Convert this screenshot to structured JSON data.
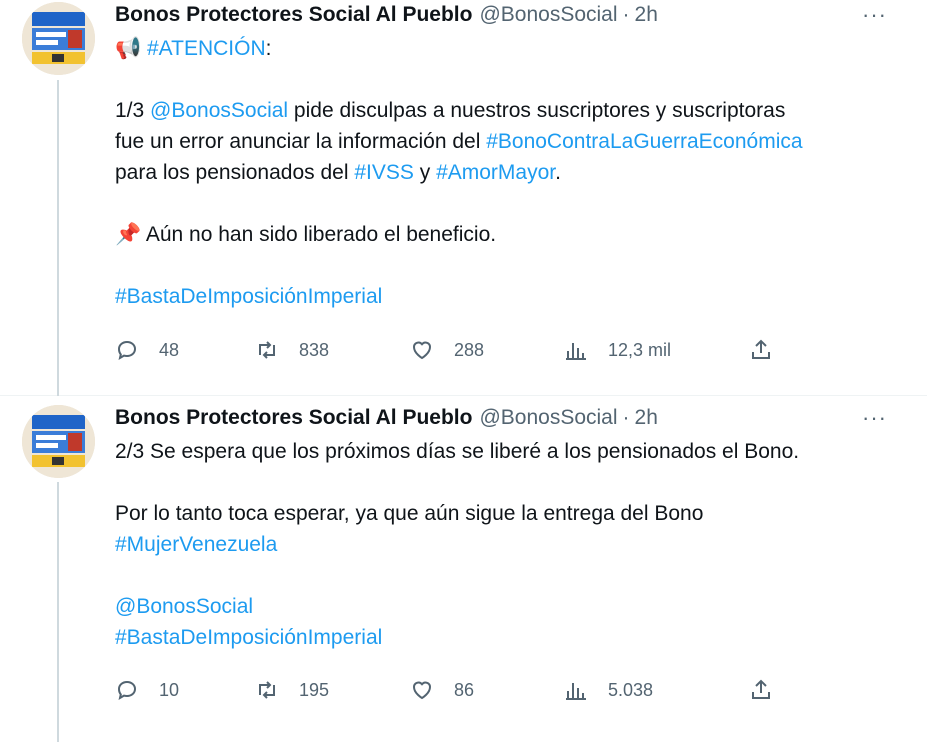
{
  "tweets": [
    {
      "author": "Bonos Protectores Social Al Pueblo",
      "handle": "@BonosSocial",
      "separator": "·",
      "time": "2h",
      "more": "···",
      "lines": {
        "l1_emoji": "📢",
        "l1_tag": "#ATENCIÓN",
        "l1_rest": ":",
        "l2_pre": "1/3 ",
        "l2_mention": "@BonosSocial",
        "l2_rest": " pide disculpas a nuestros suscriptores y suscriptoras",
        "l3_pre": "fue un error anunciar la información del ",
        "l3_tag": "#BonoContraLaGuerraEconómica",
        "l4_pre": "para los pensionados del ",
        "l4_tag1": "#IVSS",
        "l4_mid": " y ",
        "l4_tag2": "#AmorMayor",
        "l4_end": ".",
        "l5_emoji": "📌",
        "l5_text": " Aún no han sido liberado el beneficio.",
        "l6_tag": "#BastaDeImposiciónImperial"
      },
      "stats": {
        "replies": "48",
        "retweets": "838",
        "likes": "288",
        "views": "12,3 mil"
      }
    },
    {
      "author": "Bonos Protectores Social Al Pueblo",
      "handle": "@BonosSocial",
      "separator": "·",
      "time": "2h",
      "more": "···",
      "lines": {
        "l1": "2/3 Se espera que los próximos días se liberé a los pensionados el Bono.",
        "l2": "Por lo tanto toca esperar, ya que aún sigue la entrega del Bono",
        "l3_tag": "#MujerVenezuela",
        "l4_mention": "@BonosSocial",
        "l5_tag": "#BastaDeImposiciónImperial"
      },
      "stats": {
        "replies": "10",
        "retweets": "195",
        "likes": "86",
        "views": "5.038"
      }
    }
  ],
  "colors": {
    "link": "#1d9bf0",
    "muted": "#536471",
    "text": "#0f1419"
  }
}
